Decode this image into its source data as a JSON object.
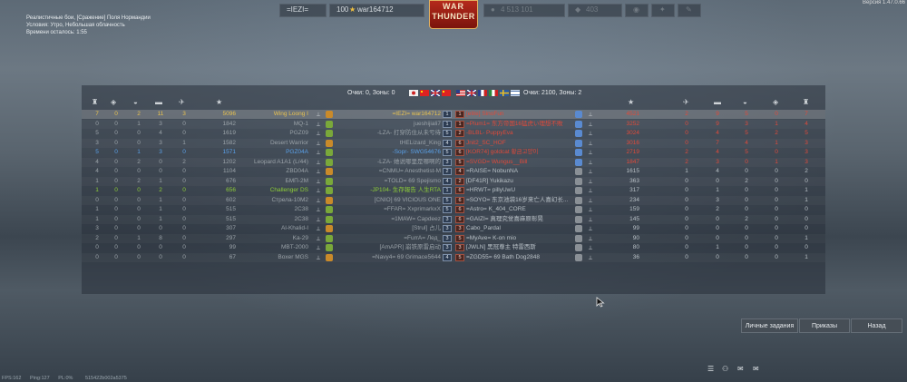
{
  "version": "Версия 1.47.0.66",
  "topbar": {
    "squad_tag": "=IEZI=",
    "level": "100",
    "username": "war164712",
    "logo_line1": "WAR",
    "logo_line2": "THUNDER",
    "silver": "4 513 101",
    "gold": "403"
  },
  "mission": {
    "name": "Реалистичные бои, [Сражение] Поля Нормандии",
    "conditions": "Условия: Утро, Небольшая облачность",
    "time_left": "Времени осталось: 1:55"
  },
  "score": {
    "left": "Очки: 0, Зоны: 0",
    "right": "Очки: 2100, Зоны: 2"
  },
  "colors": {
    "self_row": "#e8c250",
    "squad_blue": "#5aa0e8",
    "squad_green": "#8fcf38",
    "enemy_red": "#e04a3a",
    "enemy_dim": "#b8c0c6",
    "ally_dim": "#9aa2a8"
  },
  "left_team": [
    {
      "c1": "7",
      "c2": "0",
      "c3": "2",
      "c4": "11",
      "c5": "3",
      "score": "5096",
      "name": "Wing Loong I",
      "style": "self"
    },
    {
      "c1": "0",
      "c2": "0",
      "c3": "1",
      "c4": "3",
      "c5": "0",
      "score": "1842",
      "name": "MQ-1",
      "style": "dim"
    },
    {
      "c1": "5",
      "c2": "0",
      "c3": "0",
      "c4": "4",
      "c5": "0",
      "score": "1619",
      "name": "PGZ09",
      "style": "dim"
    },
    {
      "c1": "3",
      "c2": "0",
      "c3": "0",
      "c4": "3",
      "c5": "1",
      "score": "1582",
      "name": "Desert Warrior",
      "style": "dim"
    },
    {
      "c1": "5",
      "c2": "0",
      "c3": "1",
      "c4": "3",
      "c5": "0",
      "score": "1571",
      "name": "PGZ04A",
      "style": "blue"
    },
    {
      "c1": "4",
      "c2": "0",
      "c3": "2",
      "c4": "0",
      "c5": "2",
      "score": "1202",
      "name": "Leopard A1A1 (L/44)",
      "style": "dim"
    },
    {
      "c1": "4",
      "c2": "0",
      "c3": "0",
      "c4": "0",
      "c5": "0",
      "score": "1104",
      "name": "ZBD04A",
      "style": "dim"
    },
    {
      "c1": "1",
      "c2": "0",
      "c3": "2",
      "c4": "1",
      "c5": "0",
      "score": "676",
      "name": "БМП-2М",
      "style": "dim"
    },
    {
      "c1": "1",
      "c2": "0",
      "c3": "0",
      "c4": "2",
      "c5": "0",
      "score": "656",
      "name": "Challenger DS",
      "style": "green"
    },
    {
      "c1": "0",
      "c2": "0",
      "c3": "0",
      "c4": "1",
      "c5": "0",
      "score": "602",
      "name": "Стрела-10М2",
      "style": "dim"
    },
    {
      "c1": "1",
      "c2": "0",
      "c3": "0",
      "c4": "1",
      "c5": "0",
      "score": "515",
      "name": "2C38",
      "style": "dim"
    },
    {
      "c1": "1",
      "c2": "0",
      "c3": "0",
      "c4": "1",
      "c5": "0",
      "score": "515",
      "name": "2C38",
      "style": "dim"
    },
    {
      "c1": "3",
      "c2": "0",
      "c3": "0",
      "c4": "0",
      "c5": "0",
      "score": "307",
      "name": "Al-Khalid-I",
      "style": "dim"
    },
    {
      "c1": "2",
      "c2": "0",
      "c3": "1",
      "c4": "8",
      "c5": "0",
      "score": "297",
      "name": "Ka-29",
      "style": "dim"
    },
    {
      "c1": "0",
      "c2": "0",
      "c3": "0",
      "c4": "0",
      "c5": "0",
      "score": "99",
      "name": "MBT-2000",
      "style": "dim"
    },
    {
      "c1": "0",
      "c2": "0",
      "c3": "0",
      "c4": "0",
      "c5": "0",
      "score": "67",
      "name": "Boxer MGS",
      "style": "dim"
    }
  ],
  "left_players": [
    {
      "player": "=IEZI= war164712",
      "num": "1",
      "style": "self"
    },
    {
      "player": "jueshijiali7",
      "num": "1",
      "style": "dim"
    },
    {
      "player": "-LZA- 打穿防住从未亏待",
      "num": "5",
      "style": "dim"
    },
    {
      "player": "tHELizard_King",
      "num": "4",
      "style": "dim"
    },
    {
      "player": "-Sopr- SWG54676",
      "num": "5",
      "style": "blue"
    },
    {
      "player": "-LZA- 她说哪里是哪啊的",
      "num": "3",
      "style": "dim"
    },
    {
      "player": "=CNMU= Anesthetist-M",
      "num": "2",
      "style": "dim"
    },
    {
      "player": "=TOLD= 69 Spejismo",
      "num": "4",
      "style": "dim"
    },
    {
      "player": "-JP104- 生存報告 人生RTA",
      "num": "1",
      "style": "green"
    },
    {
      "player": "[CNIO] 69 VICIOUS ONE",
      "num": "5",
      "style": "dim"
    },
    {
      "player": "=FFAR= XxprimarkxX",
      "num": "5",
      "style": "dim"
    },
    {
      "player": "=1MAW= Capdeez",
      "num": "3",
      "style": "dim"
    },
    {
      "player": "[Strul] 占儿",
      "num": "3",
      "style": "dim"
    },
    {
      "player": "=FurrA= Лед_",
      "num": "3",
      "style": "dim"
    },
    {
      "player": "[AmAPR] 崩铁原雷启动",
      "num": "3",
      "style": "dim"
    },
    {
      "player": "=Navy4= 69 Grimace5644",
      "num": "4",
      "style": "dim"
    }
  ],
  "right_players": [
    {
      "num": "1",
      "player": "[elite] SinoFun",
      "style": "red"
    },
    {
      "num": "1",
      "player": "=Plum1= 东方帝国16猛虎い理想不敗",
      "style": "red"
    },
    {
      "num": "2",
      "player": "-BLBL- PuppyEva",
      "style": "red"
    },
    {
      "num": "6",
      "player": "Jnit2_SC_HOF",
      "style": "red"
    },
    {
      "num": "6",
      "player": "[KOR74] goldcat 황금고양이",
      "style": "red"
    },
    {
      "num": "5",
      "player": "=SVGD= Wungus__Bill",
      "style": "red"
    },
    {
      "num": "4",
      "player": "=RAISE= NobunNA",
      "style": "rdim"
    },
    {
      "num": "2",
      "player": "[DF41R] Yukikazu",
      "style": "rdim"
    },
    {
      "num": "6",
      "player": "=HRWT= pillyUwU",
      "style": "rdim"
    },
    {
      "num": "6",
      "player": "=SOYO= 东京池袋16岁来亡人喜幻长...",
      "style": "rdim"
    },
    {
      "num": "6",
      "player": "=Astro= K_404_CORE",
      "style": "rdim"
    },
    {
      "num": "6",
      "player": "=GAIZI= 真理究觉喜麻原彰晃",
      "style": "rdim"
    },
    {
      "num": "3",
      "player": "Cabo_Pardal",
      "style": "rdim"
    },
    {
      "num": "5",
      "player": "=MyAve= K-on mio",
      "style": "rdim"
    },
    {
      "num": "3",
      "player": "[JWLN] 黑冠尊主 特雷西斯",
      "style": "rdim"
    },
    {
      "num": "5",
      "player": "=ZGD55= 69 Bath Dog2848",
      "style": "rdim"
    }
  ],
  "right_team": [
    {
      "score": "4521",
      "c1": "2",
      "c2": "9",
      "c3": "5",
      "c4": "0",
      "c5": "7",
      "style": "red"
    },
    {
      "score": "3252",
      "c1": "0",
      "c2": "9",
      "c3": "3",
      "c4": "1",
      "c5": "4",
      "style": "red"
    },
    {
      "score": "3024",
      "c1": "0",
      "c2": "4",
      "c3": "5",
      "c4": "2",
      "c5": "5",
      "style": "red"
    },
    {
      "score": "3016",
      "c1": "0",
      "c2": "7",
      "c3": "4",
      "c4": "1",
      "c5": "3",
      "style": "red"
    },
    {
      "score": "2719",
      "c1": "2",
      "c2": "4",
      "c3": "5",
      "c4": "0",
      "c5": "3",
      "style": "red"
    },
    {
      "score": "1847",
      "c1": "2",
      "c2": "3",
      "c3": "0",
      "c4": "1",
      "c5": "3",
      "style": "red"
    },
    {
      "score": "1615",
      "c1": "1",
      "c2": "4",
      "c3": "0",
      "c4": "0",
      "c5": "2",
      "style": "rdim"
    },
    {
      "score": "363",
      "c1": "0",
      "c2": "0",
      "c3": "2",
      "c4": "0",
      "c5": "0",
      "style": "rdim"
    },
    {
      "score": "317",
      "c1": "0",
      "c2": "1",
      "c3": "0",
      "c4": "0",
      "c5": "1",
      "style": "rdim"
    },
    {
      "score": "234",
      "c1": "0",
      "c2": "3",
      "c3": "0",
      "c4": "0",
      "c5": "1",
      "style": "rdim"
    },
    {
      "score": "159",
      "c1": "0",
      "c2": "2",
      "c3": "0",
      "c4": "0",
      "c5": "0",
      "style": "rdim"
    },
    {
      "score": "145",
      "c1": "0",
      "c2": "0",
      "c3": "2",
      "c4": "0",
      "c5": "0",
      "style": "rdim"
    },
    {
      "score": "99",
      "c1": "0",
      "c2": "0",
      "c3": "0",
      "c4": "0",
      "c5": "0",
      "style": "rdim"
    },
    {
      "score": "90",
      "c1": "0",
      "c2": "0",
      "c3": "0",
      "c4": "0",
      "c5": "1",
      "style": "rdim"
    },
    {
      "score": "80",
      "c1": "0",
      "c2": "1",
      "c3": "0",
      "c4": "0",
      "c5": "0",
      "style": "rdim"
    },
    {
      "score": "36",
      "c1": "0",
      "c2": "0",
      "c3": "0",
      "c4": "0",
      "c5": "1",
      "style": "rdim"
    }
  ],
  "buttons": {
    "tasks": "Личные задания",
    "orders": "Приказы",
    "back": "Назад"
  },
  "status": {
    "fps": "FPS:162",
    "ping": "Ping:127",
    "pl": "PL:0%",
    "session": "515422b002a5375"
  }
}
